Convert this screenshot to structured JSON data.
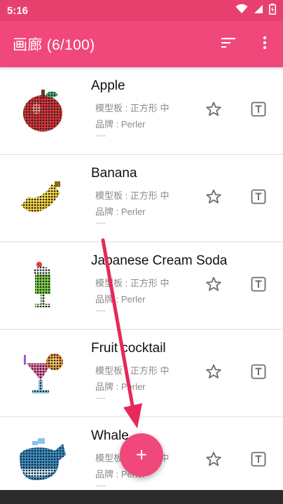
{
  "status_bar": {
    "time": "5:16",
    "icons": [
      "wifi-icon",
      "signal-icon",
      "battery-icon"
    ]
  },
  "app_bar": {
    "title": "画廊 (6/100)",
    "actions": [
      "sort-icon",
      "more-vert-icon"
    ]
  },
  "items": [
    {
      "title": "Apple",
      "board": "模型板 : 正方形 中",
      "brand": "品牌 : Perler",
      "extra": "----"
    },
    {
      "title": "Banana",
      "board": "模型板 : 正方形 中",
      "brand": "品牌 : Perler",
      "extra": "----"
    },
    {
      "title": "Japanese Cream Soda",
      "board": "模型板 : 正方形 中",
      "brand": "品牌 : Perler",
      "extra": "----"
    },
    {
      "title": "Fruit cocktail",
      "board": "模型板 : 正方形 中",
      "brand": "品牌 : Perler",
      "extra": "----"
    },
    {
      "title": "Whale",
      "board": "模型板 : 正方形 中",
      "brand": "品牌 : Perler",
      "extra": "----"
    }
  ],
  "fab": {
    "label": "+"
  },
  "colors": {
    "primary": "#f0487a",
    "status_bar": "#e8406e",
    "nav_bar": "#2b2b2b",
    "annotation_arrow": "#e8285a"
  }
}
